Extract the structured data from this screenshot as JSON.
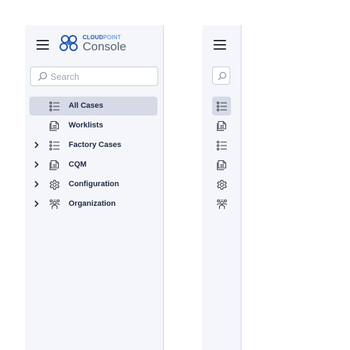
{
  "brand": {
    "company_part1": "CLOUD",
    "company_part2": "POINT",
    "product": "Console"
  },
  "search": {
    "placeholder": "Search"
  },
  "nav": [
    {
      "label": "All Cases",
      "icon": "list-icon",
      "expandable": false,
      "active": true
    },
    {
      "label": "Worklists",
      "icon": "document-icon",
      "expandable": false,
      "active": false
    },
    {
      "label": "Factory Cases",
      "icon": "list-icon",
      "expandable": true,
      "active": false
    },
    {
      "label": "CQM",
      "icon": "document-icon",
      "expandable": true,
      "active": false
    },
    {
      "label": "Configuration",
      "icon": "gear-icon",
      "expandable": true,
      "active": false
    },
    {
      "label": "Organization",
      "icon": "people-icon",
      "expandable": true,
      "active": false
    }
  ],
  "colors": {
    "panel_bg": "#f4f6fa",
    "active_bg": "#d6dae6",
    "brand_blue": "#2456a6",
    "text": "#1f2a44"
  }
}
